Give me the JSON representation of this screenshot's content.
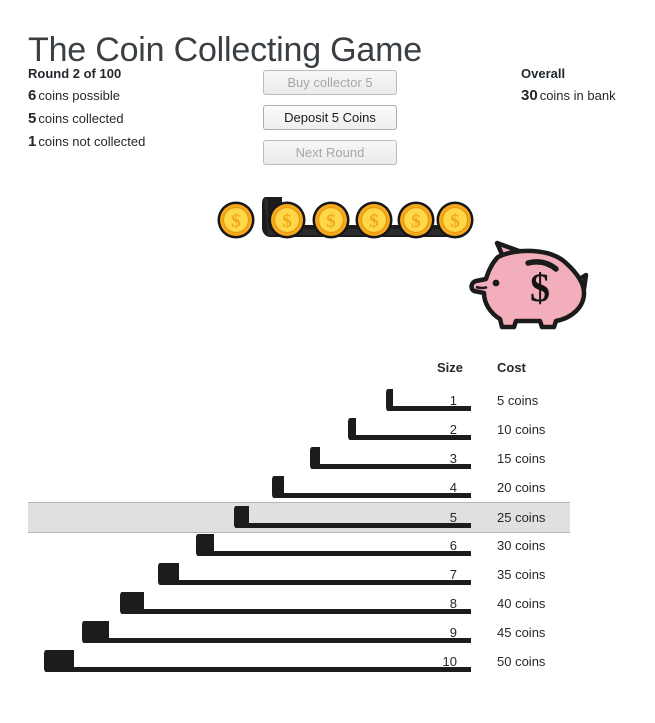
{
  "page": {
    "title": "The Coin Collecting Game",
    "background_color": "#ffffff",
    "text_color": "#23282d"
  },
  "status": {
    "round_label": "Round 2 of 100",
    "round_current": 2,
    "round_total": 100,
    "lines": [
      {
        "number": "6",
        "label": "coins possible"
      },
      {
        "number": "5",
        "label": "coins collected"
      },
      {
        "number": "1",
        "label": "coins not collected"
      }
    ]
  },
  "buttons": [
    {
      "name": "buy-collector-button",
      "label": "Buy collector 5",
      "disabled": true
    },
    {
      "name": "deposit-coins-button",
      "label": "Deposit 5 Coins",
      "disabled": false
    },
    {
      "name": "next-round-button",
      "label": "Next Round",
      "disabled": true
    }
  ],
  "overall": {
    "title": "Overall",
    "bank_number": "30",
    "bank_label": "coins in bank"
  },
  "arena": {
    "coin_icon": "gold-coin-icon",
    "piggy_icon": "piggy-bank-icon",
    "coins_total": 6,
    "coins_collected": 5,
    "active_collector_size": 5,
    "coin_color_outer": "#f5a623",
    "coin_color_inner": "#ffd24d",
    "collector_color": "#1c1c1c",
    "piggy_color": "#f3aebc"
  },
  "table": {
    "headers": {
      "size": "Size",
      "cost": "Cost"
    },
    "selected_size": 5,
    "highlight_color": "#e0e0e0",
    "rows": [
      {
        "size": "1",
        "cost": "5 coins",
        "size_value": 1
      },
      {
        "size": "2",
        "cost": "10 coins",
        "size_value": 2
      },
      {
        "size": "3",
        "cost": "15 coins",
        "size_value": 3
      },
      {
        "size": "4",
        "cost": "20 coins",
        "size_value": 4
      },
      {
        "size": "5",
        "cost": "25 coins",
        "size_value": 5
      },
      {
        "size": "6",
        "cost": "30 coins",
        "size_value": 6
      },
      {
        "size": "7",
        "cost": "35 coins",
        "size_value": 7
      },
      {
        "size": "8",
        "cost": "40 coins",
        "size_value": 8
      },
      {
        "size": "9",
        "cost": "45 coins",
        "size_value": 9
      },
      {
        "size": "10",
        "cost": "50 coins",
        "size_value": 10
      }
    ]
  }
}
